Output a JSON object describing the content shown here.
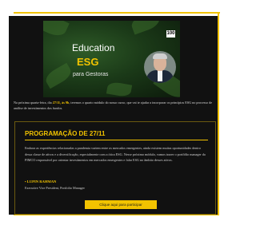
{
  "banner": {
    "title_line1": "Education",
    "title_line2": "ESG",
    "subtitle": "para Gestoras",
    "logo_text": "100",
    "colors": {
      "accent": "#f2c300",
      "background": "#111111"
    }
  },
  "intro": {
    "text_before": "Na próxima quarta-feira, dia ",
    "highlight": "27/11, às 9h",
    "text_after": ", teremos o quarto módulo do nosso curso, que vai te ajudar a incorporar os princípios ESG no processo de análise de investimentos dos fundos."
  },
  "program": {
    "title": "PROGRAMAÇÃO DE 27/11",
    "description": "Embora as experiências relacionadas a pandemia variem entre os mercados emergentes, ainda existem muitas oportunidades dentro dessa classe de ativos e a diversificação, especialmente com a ótica ESG. Nesse próximo módulo, vamos trazer o portfólio manager da PIMCO responsável por orientar investimentos em mercados emergentes e falar ESG no âmbito desses ativos.",
    "speaker_name": "• LUPIN RAHMAN",
    "speaker_role": "Executive Vice President, Portfolio Manager",
    "cta_label": "Clique aqui para participar"
  }
}
